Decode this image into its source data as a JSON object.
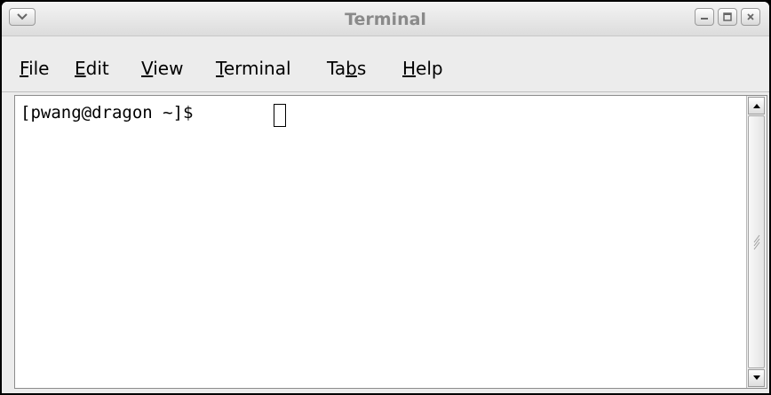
{
  "window": {
    "title": "Terminal"
  },
  "menu": [
    {
      "pre": "",
      "u": "F",
      "post": "ile"
    },
    {
      "pre": "",
      "u": "E",
      "post": "dit"
    },
    {
      "pre": "",
      "u": "V",
      "post": "iew"
    },
    {
      "pre": "",
      "u": "T",
      "post": "erminal"
    },
    {
      "pre": "Ta",
      "u": "b",
      "post": "s"
    },
    {
      "pre": "",
      "u": "H",
      "post": "elp"
    }
  ],
  "terminal": {
    "prompt": "[pwang@dragon ~]$ "
  },
  "icons": {
    "window_menu": "chevron-down-icon",
    "minimize": "minimize-icon",
    "maximize": "maximize-icon",
    "close": "close-icon",
    "scroll_up": "arrow-up-icon",
    "scroll_down": "arrow-down-icon"
  }
}
